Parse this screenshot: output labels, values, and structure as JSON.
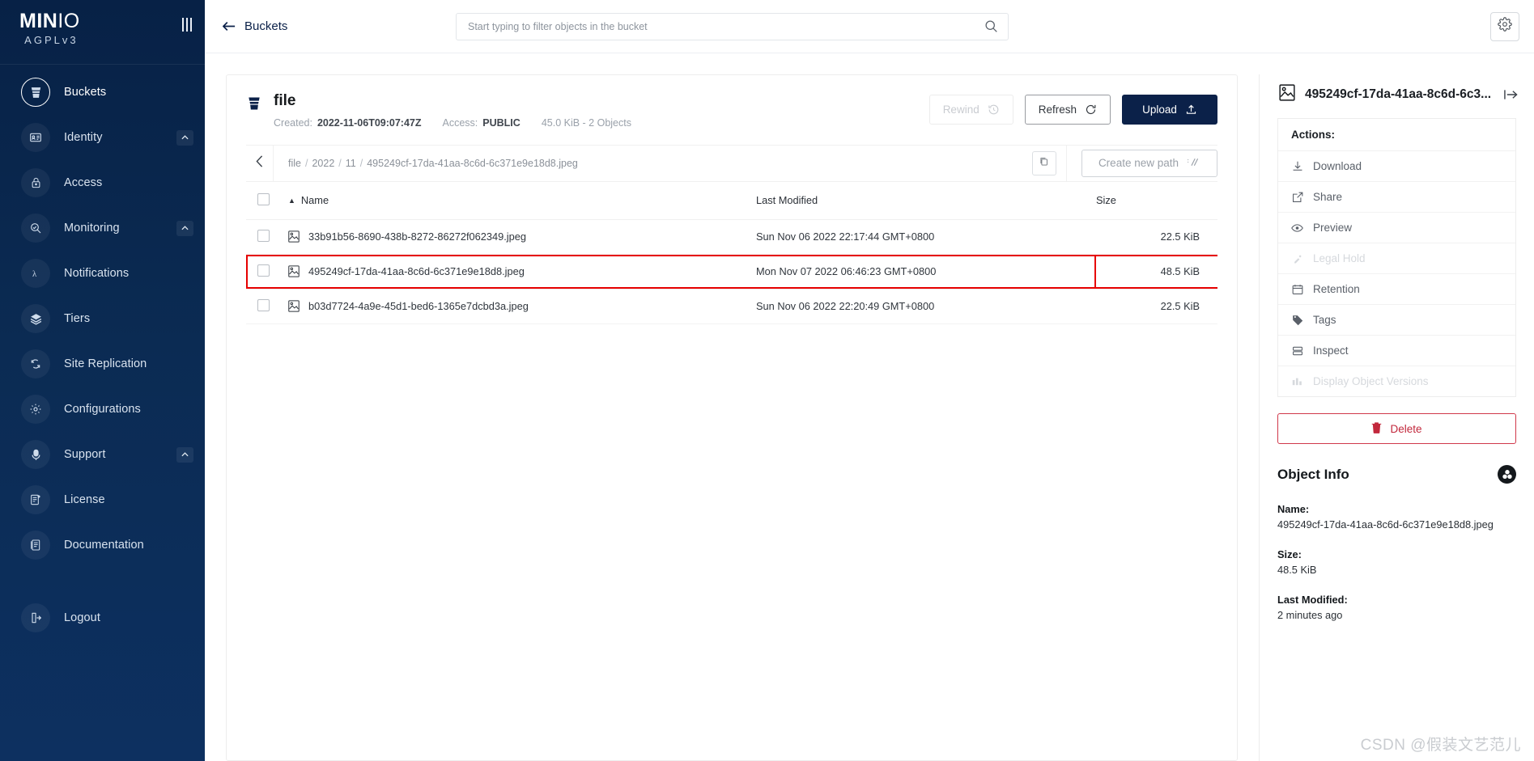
{
  "sidebar": {
    "brand": {
      "logo_main": "MIN",
      "logo_accent": "IO",
      "license": "AGPLv3"
    },
    "items": [
      {
        "label": "Buckets",
        "icon": "bucket-icon",
        "active": true,
        "caret": false
      },
      {
        "label": "Identity",
        "icon": "identity-icon",
        "active": false,
        "caret": true
      },
      {
        "label": "Access",
        "icon": "lock-icon",
        "active": false,
        "caret": false
      },
      {
        "label": "Monitoring",
        "icon": "monitoring-icon",
        "active": false,
        "caret": true
      },
      {
        "label": "Notifications",
        "icon": "lambda-icon",
        "active": false,
        "caret": false
      },
      {
        "label": "Tiers",
        "icon": "layers-icon",
        "active": false,
        "caret": false
      },
      {
        "label": "Site Replication",
        "icon": "replication-icon",
        "active": false,
        "caret": false
      },
      {
        "label": "Configurations",
        "icon": "gear-icon",
        "active": false,
        "caret": false
      },
      {
        "label": "Support",
        "icon": "support-icon",
        "active": false,
        "caret": true
      },
      {
        "label": "License",
        "icon": "license-icon",
        "active": false,
        "caret": false
      },
      {
        "label": "Documentation",
        "icon": "docs-icon",
        "active": false,
        "caret": false
      },
      {
        "label": "Logout",
        "icon": "logout-icon",
        "active": false,
        "caret": false
      }
    ]
  },
  "topbar": {
    "back_label": "Buckets",
    "search_placeholder": "Start typing to filter objects in the bucket",
    "search_value": ""
  },
  "bucket": {
    "name": "file",
    "created_key": "Created:",
    "created_value": "2022-11-06T09:07:47Z",
    "access_key": "Access:",
    "access_value": "PUBLIC",
    "summary": "45.0 KiB - 2 Objects",
    "rewind_label": "Rewind",
    "refresh_label": "Refresh",
    "upload_label": "Upload"
  },
  "path": {
    "crumbs": [
      "file",
      "2022",
      "11",
      "495249cf-17da-41aa-8c6d-6c371e9e18d8.jpeg"
    ],
    "create_new_path_label": "Create new path"
  },
  "table": {
    "headers": {
      "name": "Name",
      "last_modified": "Last Modified",
      "size": "Size"
    },
    "sort_indicator": "▲",
    "rows": [
      {
        "name": "33b91b56-8690-438b-8272-86272f062349.jpeg",
        "last_modified": "Sun Nov 06 2022 22:17:44 GMT+0800",
        "size": "22.5 KiB",
        "selected": false
      },
      {
        "name": "495249cf-17da-41aa-8c6d-6c371e9e18d8.jpeg",
        "last_modified": "Mon Nov 07 2022 06:46:23 GMT+0800",
        "size": "48.5 KiB",
        "selected": true
      },
      {
        "name": "b03d7724-4a9e-45d1-bed6-1365e7dcbd3a.jpeg",
        "last_modified": "Sun Nov 06 2022 22:20:49 GMT+0800",
        "size": "22.5 KiB",
        "selected": false
      }
    ]
  },
  "details": {
    "title": "495249cf-17da-41aa-8c6d-6c3...",
    "actions_title": "Actions:",
    "actions": [
      {
        "label": "Download",
        "icon": "download-icon",
        "disabled": false
      },
      {
        "label": "Share",
        "icon": "share-icon",
        "disabled": false
      },
      {
        "label": "Preview",
        "icon": "eye-icon",
        "disabled": false
      },
      {
        "label": "Legal Hold",
        "icon": "legal-hold-icon",
        "disabled": true
      },
      {
        "label": "Retention",
        "icon": "calendar-icon",
        "disabled": false
      },
      {
        "label": "Tags",
        "icon": "tag-icon",
        "disabled": false
      },
      {
        "label": "Inspect",
        "icon": "inspect-icon",
        "disabled": false
      },
      {
        "label": "Display Object Versions",
        "icon": "versions-icon",
        "disabled": true
      }
    ],
    "delete_label": "Delete",
    "object_info_title": "Object Info",
    "info": [
      {
        "key": "Name:",
        "value": "495249cf-17da-41aa-8c6d-6c371e9e18d8.jpeg"
      },
      {
        "key": "Size:",
        "value": "48.5 KiB"
      },
      {
        "key": "Last Modified:",
        "value": "2 minutes ago"
      }
    ]
  },
  "watermark": "CSDN @假装文艺范儿",
  "colors": {
    "sidebar_bg": "#072146",
    "primary": "#0b2149",
    "danger": "#c2283c",
    "highlight": "#e60000"
  }
}
